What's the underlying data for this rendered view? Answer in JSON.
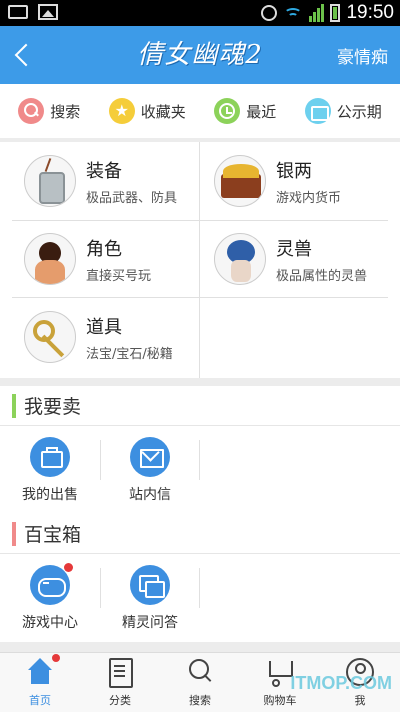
{
  "status_bar": {
    "time": "19:50",
    "icons": [
      "message-icon",
      "image-icon",
      "alarm-icon",
      "wifi-icon",
      "signal-icon",
      "battery-icon"
    ]
  },
  "header": {
    "back_icon": "chevron-left-icon",
    "title": "倩女幽魂2",
    "user_name": "豪情痴",
    "background_color": "#3d9be8"
  },
  "quick_links": [
    {
      "label": "搜索",
      "icon": "search-icon",
      "color": "#f08a8a"
    },
    {
      "label": "收藏夹",
      "icon": "star-icon",
      "color": "#f5cd3a"
    },
    {
      "label": "最近",
      "icon": "clock-icon",
      "color": "#8cd25a"
    },
    {
      "label": "公示期",
      "icon": "notice-icon",
      "color": "#6dd0ee"
    }
  ],
  "categories": [
    {
      "title": "装备",
      "subtitle": "极品武器、防具",
      "icon": "amulet-icon"
    },
    {
      "title": "银两",
      "subtitle": "游戏内货币",
      "icon": "treasure-chest-icon"
    },
    {
      "title": "角色",
      "subtitle": "直接买号玩",
      "icon": "character-icon"
    },
    {
      "title": "灵兽",
      "subtitle": "极品属性的灵兽",
      "icon": "spirit-pet-icon"
    },
    {
      "title": "道具",
      "subtitle": "法宝/宝石/秘籍",
      "icon": "key-icon"
    }
  ],
  "sell_section": {
    "title": "我要卖",
    "accent_color": "#8cd25a",
    "items": [
      {
        "label": "我的出售",
        "icon": "briefcase-icon"
      },
      {
        "label": "站内信",
        "icon": "mail-icon"
      }
    ]
  },
  "toolbox_section": {
    "title": "百宝箱",
    "accent_color": "#f08a8a",
    "items": [
      {
        "label": "游戏中心",
        "icon": "gamepad-icon",
        "badge": true
      },
      {
        "label": "精灵问答",
        "icon": "chat-icon"
      }
    ]
  },
  "tab_bar": {
    "active_index": 0,
    "active_color": "#3d8fe0",
    "tabs": [
      {
        "label": "首页",
        "icon": "home-icon",
        "badge": true
      },
      {
        "label": "分类",
        "icon": "list-icon"
      },
      {
        "label": "搜索",
        "icon": "search-icon"
      },
      {
        "label": "购物车",
        "icon": "cart-icon"
      },
      {
        "label": "我",
        "icon": "user-icon"
      }
    ]
  },
  "watermark": "ITMOP.COM"
}
